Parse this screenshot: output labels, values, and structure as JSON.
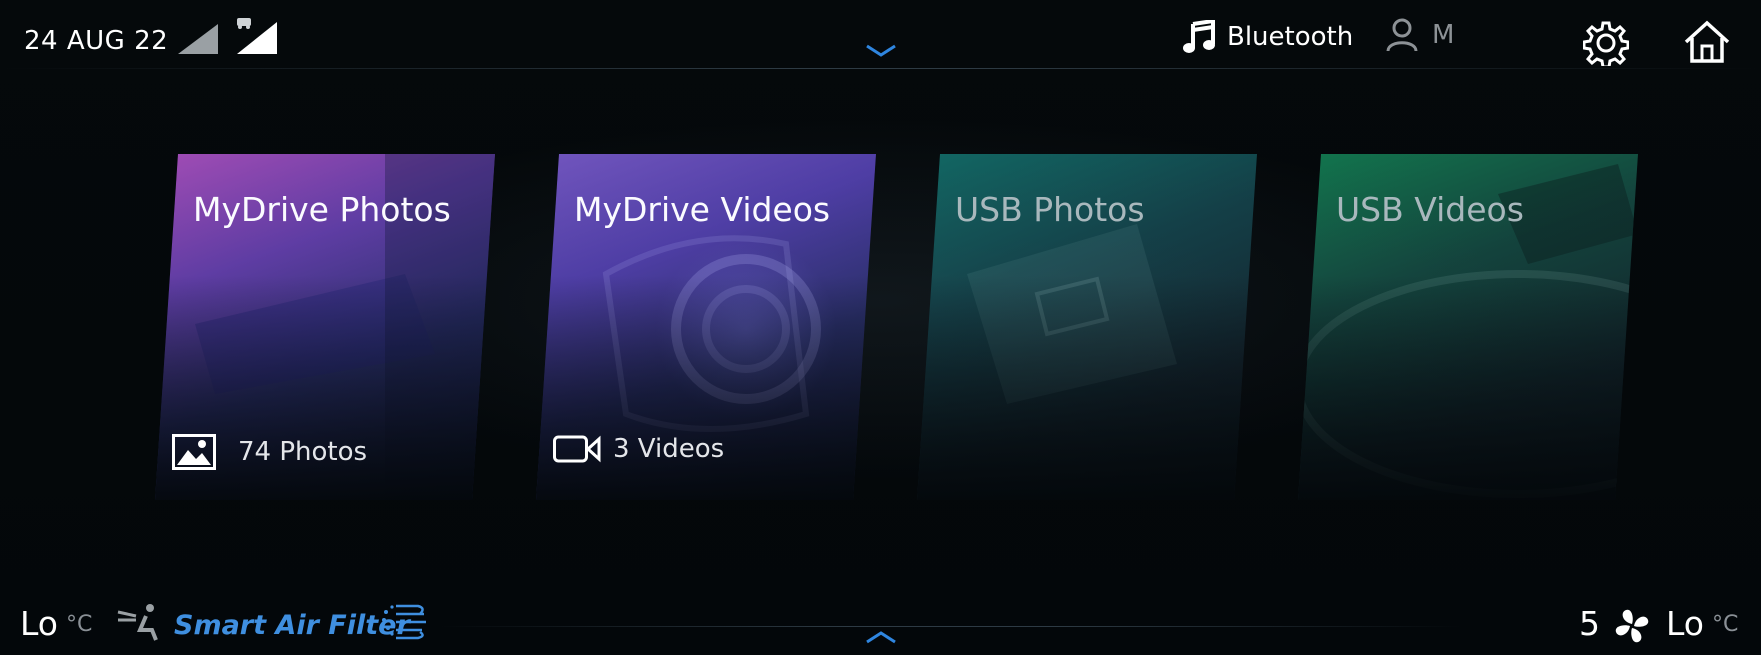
{
  "status_bar": {
    "date": "24 AUG 22",
    "audio_source": "Bluetooth",
    "profile_initial": "M"
  },
  "tiles": [
    {
      "title": "MyDrive Photos",
      "meta": "74 Photos"
    },
    {
      "title": "MyDrive Videos",
      "meta": "3 Videos"
    },
    {
      "title": "USB Photos",
      "meta": ""
    },
    {
      "title": "USB Videos",
      "meta": ""
    }
  ],
  "climate": {
    "left_temp": "Lo",
    "left_unit": "°C",
    "air_filter_label": "Smart Air Filter",
    "fan_speed": "5",
    "right_temp": "Lo",
    "right_unit": "°C"
  },
  "colors": {
    "accent": "#3f8fe0",
    "background": "#04090c"
  },
  "icons": [
    "signal-icon",
    "car-signal-icon",
    "chevron-down-icon",
    "music-note-icon",
    "user-icon",
    "gear-icon",
    "home-icon",
    "image-icon",
    "video-camera-icon",
    "seat-icon",
    "air-filter-icon",
    "chevron-up-icon",
    "fan-icon"
  ]
}
